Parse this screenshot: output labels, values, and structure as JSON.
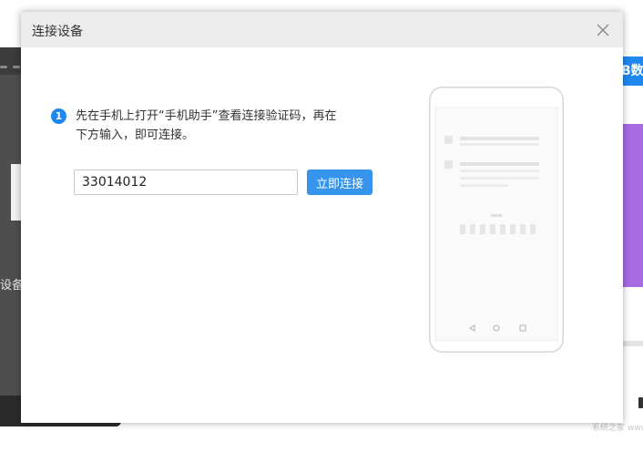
{
  "background": {
    "left_panel_text": "设备",
    "right_button_text": "B数",
    "watermark": "系统之家 www.xitongzhijia.net"
  },
  "dialog": {
    "title": "连接设备",
    "close_icon": "close-icon",
    "step": {
      "number": "1",
      "instruction_line1": "先在手机上打开“手机助手”查看连接验证码，再在",
      "instruction_line2": "下方输入，即可连接。"
    },
    "code_input": {
      "value": "33014012",
      "placeholder": ""
    },
    "connect_button_label": "立即连接",
    "illustration": {
      "icon": "phone-illustration-icon",
      "nav_icons": [
        "back-icon",
        "home-icon",
        "recents-icon"
      ]
    }
  },
  "colors": {
    "accent": "#1e88f0",
    "button": "#3794ec",
    "header_bg": "#ececec",
    "side_panel": "#4e4e4e",
    "purple_card": "#a66be0"
  }
}
